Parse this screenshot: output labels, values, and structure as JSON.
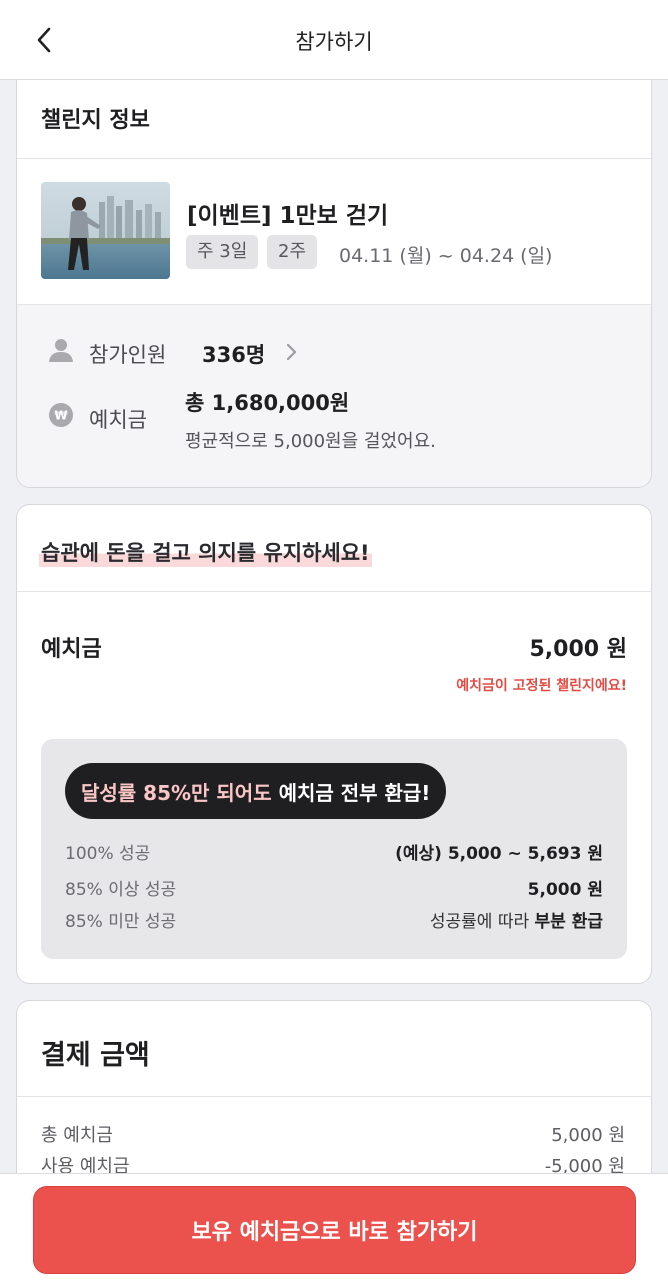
{
  "header": {
    "title": "참가하기",
    "back_icon": "chevron-left-icon"
  },
  "info_card": {
    "section_title": "챌린지 정보",
    "challenge": {
      "title": "[이벤트] 1만보 걷기",
      "tags": [
        "주 3일",
        "2주"
      ],
      "dates": "04.11 (월) ~ 04.24 (일)"
    },
    "participants": {
      "label": "참가인원",
      "value": "336명"
    },
    "deposit": {
      "label": "예치금",
      "total": "총 1,680,000원",
      "sub": "평균적으로 5,000원을 걸었어요."
    }
  },
  "deposit_card": {
    "slogan": "습관에 돈을 걸고 의지를 유지하세요!",
    "label": "예치금",
    "amount": "5,000 원",
    "note": "예치금이 고정된 챌린지에요!",
    "refund_pill": {
      "highlight": "달성률 85%만 되어도",
      "rest": " 예치금 전부 환급!"
    },
    "refund_rows": [
      {
        "label": "100% 성공",
        "value": "(예상) 5,000 ~ 5,693 원"
      },
      {
        "label": "85% 이상 성공",
        "value": "5,000 원"
      },
      {
        "label": "85% 미만 성공",
        "value_prefix": "성공률에 따라 ",
        "value_bold": "부분 환급"
      }
    ]
  },
  "payment_card": {
    "title": "결제 금액",
    "rows": [
      {
        "label": "총 예치금",
        "value": "5,000 원"
      },
      {
        "label": "사용 예치금",
        "value": "-5,000 원"
      }
    ]
  },
  "cta": {
    "label": "보유 예치금으로 바로 참가하기"
  },
  "colors": {
    "accent": "#ec524d",
    "note_red": "#e24c44",
    "pill_bg": "#1f1f22",
    "pill_highlight": "#fbc6c6"
  }
}
